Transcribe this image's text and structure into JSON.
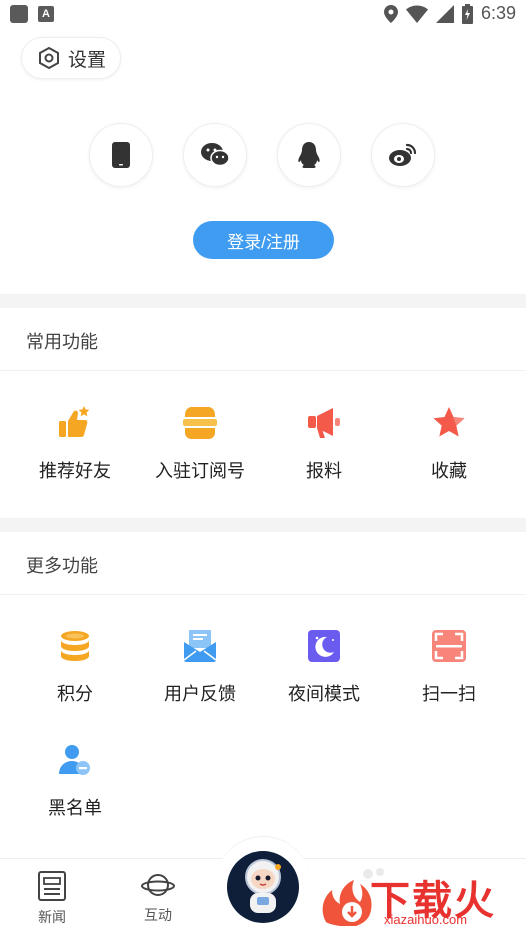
{
  "status_bar": {
    "time": "6:39",
    "app_badge": "A"
  },
  "settings": {
    "label": "设置"
  },
  "login": {
    "methods": [
      {
        "icon": "phone-icon"
      },
      {
        "icon": "wechat-icon"
      },
      {
        "icon": "qq-icon"
      },
      {
        "icon": "weibo-icon"
      }
    ],
    "button_label": "登录/注册",
    "accent": "#3f9cf0"
  },
  "common_functions": {
    "title": "常用功能",
    "items": [
      {
        "label": "推荐好友",
        "icon": "thumbs-up-icon",
        "color": "#f5a623"
      },
      {
        "label": "入驻订阅号",
        "icon": "subscribe-box-icon",
        "color": "#f5a623"
      },
      {
        "label": "报料",
        "icon": "megaphone-icon",
        "color": "#f35a4a"
      },
      {
        "label": "收藏",
        "icon": "star-icon",
        "color": "#f35a4a"
      }
    ]
  },
  "more_functions": {
    "title": "更多功能",
    "items": [
      {
        "label": "积分",
        "icon": "coins-icon",
        "color": "#f5a623"
      },
      {
        "label": "用户反馈",
        "icon": "mail-icon",
        "color": "#3f9cf0"
      },
      {
        "label": "夜间模式",
        "icon": "moon-icon",
        "color": "#6b5cf0"
      },
      {
        "label": "扫一扫",
        "icon": "scan-icon",
        "color": "#f35a4a"
      },
      {
        "label": "黑名单",
        "icon": "blacklist-user-icon",
        "color": "#3f9cf0"
      }
    ]
  },
  "bottom_nav": {
    "items": [
      {
        "label": "新闻",
        "icon": "news-icon"
      },
      {
        "label": "互动",
        "icon": "planet-icon"
      }
    ]
  },
  "watermark": {
    "text": "下载火",
    "sub": "xiazaihuo.com"
  }
}
